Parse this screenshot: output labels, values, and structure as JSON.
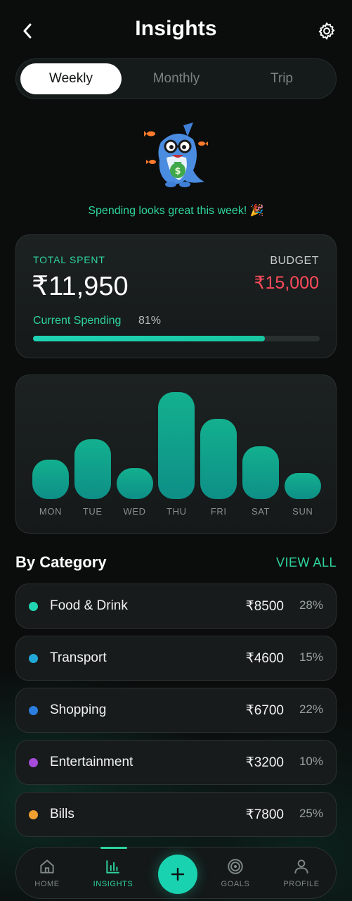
{
  "header": {
    "title": "Insights"
  },
  "period_tabs": [
    "Weekly",
    "Monthly",
    "Trip"
  ],
  "active_tab": "Weekly",
  "tagline": "Spending looks great this week! 🎉",
  "summary": {
    "total_label": "TOTAL SPENT",
    "total_amount": "₹11,950",
    "budget_label": "BUDGET",
    "budget_amount": "₹15,000",
    "current_label": "Current Spending",
    "current_percent": "81%",
    "progress_fraction": 0.81
  },
  "chart_data": {
    "type": "bar",
    "categories": [
      "MON",
      "TUE",
      "WED",
      "THU",
      "FRI",
      "SAT",
      "SUN"
    ],
    "values": [
      56,
      85,
      44,
      152,
      114,
      75,
      37
    ],
    "title": "",
    "xlabel": "",
    "ylabel": ""
  },
  "categories_section": {
    "title": "By Category",
    "view_all": "VIEW ALL",
    "items": [
      {
        "name": "Food & Drink",
        "amount": "₹8500",
        "percent": "28%",
        "color": "#22d6b4"
      },
      {
        "name": "Transport",
        "amount": "₹4600",
        "percent": "15%",
        "color": "#21a8d8"
      },
      {
        "name": "Shopping",
        "amount": "₹6700",
        "percent": "22%",
        "color": "#2c7de0"
      },
      {
        "name": "Entertainment",
        "amount": "₹3200",
        "percent": "10%",
        "color": "#a64bdc"
      },
      {
        "name": "Bills",
        "amount": "₹7800",
        "percent": "25%",
        "color": "#f0a030"
      }
    ]
  },
  "nav": {
    "items": [
      {
        "label": "HOME",
        "icon": "home-icon"
      },
      {
        "label": "INSIGHTS",
        "icon": "bar-chart-icon"
      },
      {
        "label": "GOALS",
        "icon": "target-icon"
      },
      {
        "label": "PROFILE",
        "icon": "user-icon"
      }
    ],
    "active": "INSIGHTS"
  },
  "colors": {
    "accent": "#2fd49c",
    "budget": "#ff4b5c",
    "background": "#0b0d0d",
    "bar": "#13b08f"
  }
}
